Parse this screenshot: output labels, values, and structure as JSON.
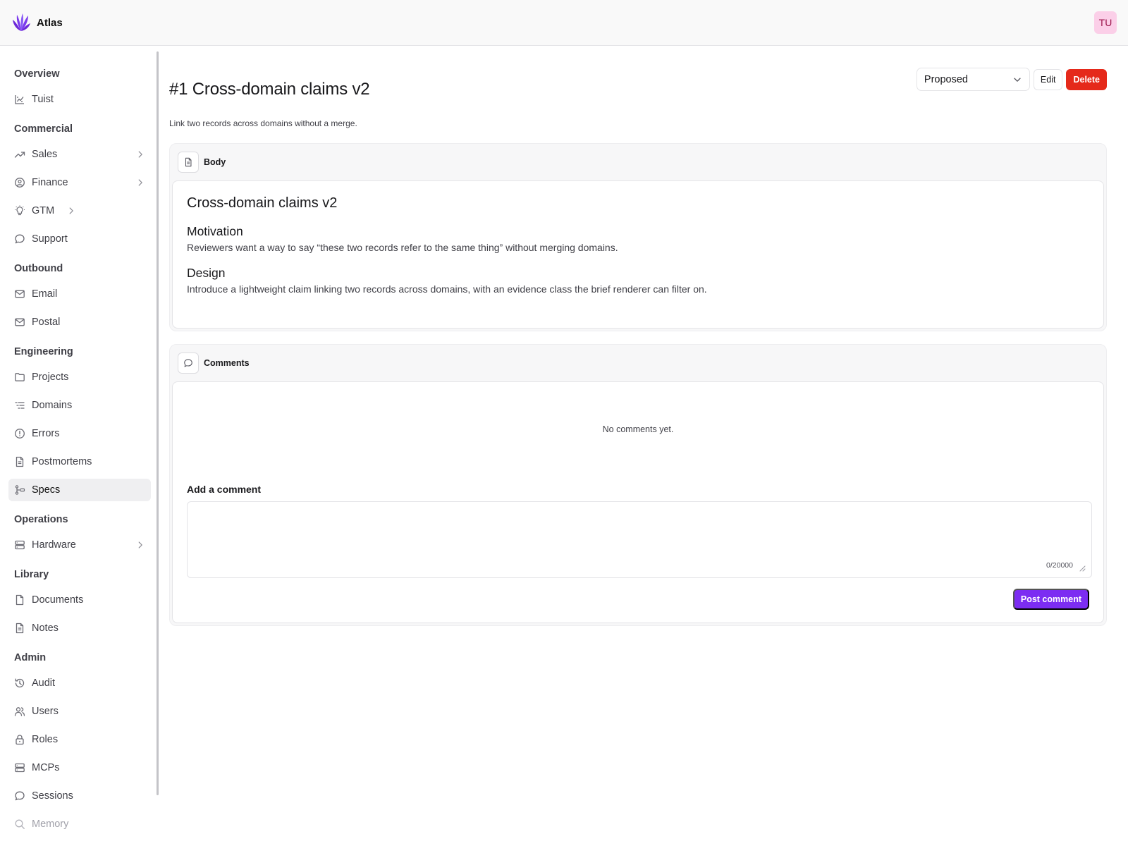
{
  "app": {
    "name": "Atlas",
    "user_initials": "TU"
  },
  "sidebar": {
    "groups": [
      {
        "label": "Overview",
        "items": [
          {
            "label": "Tuist",
            "icon": "chart-icon"
          }
        ]
      },
      {
        "label": "Commercial",
        "items": [
          {
            "label": "Sales",
            "icon": "trend-icon",
            "expandable": true
          },
          {
            "label": "Finance",
            "icon": "coin-icon",
            "expandable": true
          },
          {
            "label": "GTM",
            "icon": "bulb-icon",
            "expandable": true
          },
          {
            "label": "Support",
            "icon": "chat-icon"
          }
        ]
      },
      {
        "label": "Outbound",
        "items": [
          {
            "label": "Email",
            "icon": "mail-icon"
          },
          {
            "label": "Postal",
            "icon": "mail-icon"
          }
        ]
      },
      {
        "label": "Engineering",
        "items": [
          {
            "label": "Projects",
            "icon": "folder-icon"
          },
          {
            "label": "Domains",
            "icon": "list-icon"
          },
          {
            "label": "Errors",
            "icon": "alert-icon"
          },
          {
            "label": "Postmortems",
            "icon": "doc-icon"
          },
          {
            "label": "Specs",
            "icon": "spec-icon",
            "active": true
          }
        ]
      },
      {
        "label": "Operations",
        "items": [
          {
            "label": "Hardware",
            "icon": "server-icon",
            "expandable": true
          }
        ]
      },
      {
        "label": "Library",
        "items": [
          {
            "label": "Documents",
            "icon": "file-icon"
          },
          {
            "label": "Notes",
            "icon": "doc-icon"
          }
        ]
      },
      {
        "label": "Admin",
        "items": [
          {
            "label": "Audit",
            "icon": "history-icon"
          },
          {
            "label": "Users",
            "icon": "users-icon"
          },
          {
            "label": "Roles",
            "icon": "lock-icon"
          },
          {
            "label": "MCPs",
            "icon": "server-icon"
          },
          {
            "label": "Sessions",
            "icon": "chat-icon"
          },
          {
            "label": "Memory",
            "icon": "search-icon"
          }
        ]
      }
    ]
  },
  "spec": {
    "title": "#1 Cross-domain claims v2",
    "summary": "Link two records across domains without a merge.",
    "status": "Proposed",
    "edit_label": "Edit",
    "delete_label": "Delete"
  },
  "body_card": {
    "label": "Body",
    "heading": "Cross-domain claims v2",
    "sections": [
      {
        "heading": "Motivation",
        "text": "Reviewers want a way to say “these two records refer to the same thing” without merging domains."
      },
      {
        "heading": "Design",
        "text": "Introduce a lightweight claim linking two records across domains, with an evidence class the brief renderer can filter on."
      }
    ]
  },
  "comments_card": {
    "label": "Comments",
    "empty_text": "No comments yet.",
    "add_label": "Add a comment",
    "input_value": "",
    "char_count": "0/20000",
    "post_label": "Post comment"
  },
  "colors": {
    "accent": "#7c2df2",
    "danger": "#e5291a",
    "avatar_bg": "#fbcfe8"
  }
}
